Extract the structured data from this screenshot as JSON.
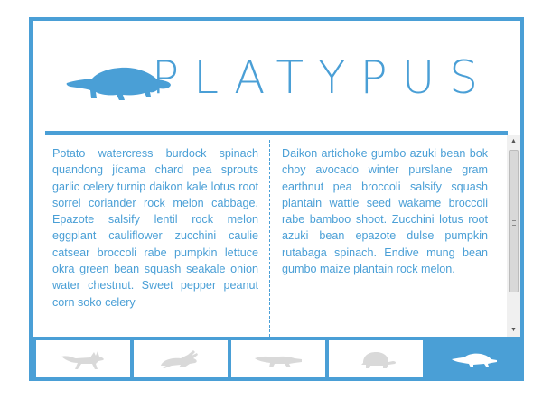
{
  "header": {
    "title": "PLATYPUS",
    "logo": "platypus-icon"
  },
  "content": {
    "left_column": "Potato watercress burdock spinach quandong jícama chard pea sprouts garlic celery turnip daikon kale lotus root sorrel coriander rock melon cabbage. Epazote salsify lentil rock melon eggplant cauliflower zucchini caulie catsear broccoli rabe pumpkin lettuce okra green bean squash seakale onion water chestnut. Sweet pepper peanut corn soko celery",
    "right_column": "Daikon artichoke gumbo azuki bean bok choy avocado winter purslane gram earthnut pea broccoli salsify squash plantain wattle seed wakame broccoli rabe bamboo shoot. Zucchini lotus root azuki bean epazote dulse pumpkin rutabaga spinach. Endive mung bean gumbo maize plantain rock melon."
  },
  "tabs": [
    {
      "icon": "fox-icon",
      "active": false
    },
    {
      "icon": "rabbit-icon",
      "active": false
    },
    {
      "icon": "crocodile-icon",
      "active": false
    },
    {
      "icon": "turtle-icon",
      "active": false
    },
    {
      "icon": "platypus-icon",
      "active": true
    }
  ],
  "colors": {
    "accent": "#4a9fd6",
    "inactive_icon": "#d9d9d9",
    "active_icon": "#ffffff"
  }
}
